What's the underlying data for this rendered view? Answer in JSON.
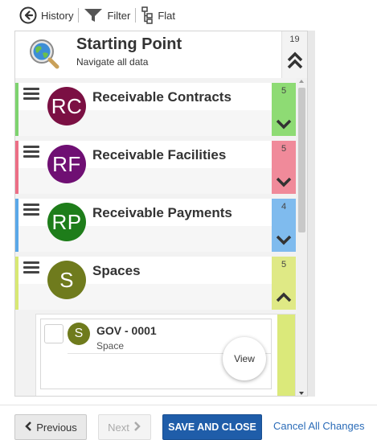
{
  "toolbar": {
    "history_label": "History",
    "filter_label": "Filter",
    "flat_label": "Flat"
  },
  "starting_point": {
    "title": "Starting Point",
    "subtitle": "Navigate all data",
    "count": "19"
  },
  "cards": [
    {
      "initials": "RC",
      "name": "Receivable Contracts",
      "count": "5",
      "expanded": false,
      "accent": "#7ed36f",
      "side": "#8edb74",
      "avatar": "#7b1043"
    },
    {
      "initials": "RF",
      "name": "Receivable Facilities",
      "count": "5",
      "expanded": false,
      "accent": "#ec6f86",
      "side": "#f08a9a",
      "avatar": "#6f0f73"
    },
    {
      "initials": "RP",
      "name": "Receivable Payments",
      "count": "4",
      "expanded": false,
      "accent": "#5aa8e8",
      "side": "#7fbbee",
      "avatar": "#1e7d1a"
    },
    {
      "initials": "S",
      "name": "Spaces",
      "count": "5",
      "expanded": true,
      "accent": "#d8e873",
      "side": "#dfe985",
      "avatar": "#6f7b1d"
    }
  ],
  "child": {
    "initials": "S",
    "title": "GOV - 0001",
    "subtitle": "Space",
    "view_label": "View"
  },
  "footer": {
    "previous_label": "Previous",
    "next_label": "Next",
    "save_label": "SAVE AND CLOSE",
    "cancel_label": "Cancel All Changes"
  },
  "colors": {
    "primary": "#1f5da9",
    "link": "#2b6cb8"
  }
}
